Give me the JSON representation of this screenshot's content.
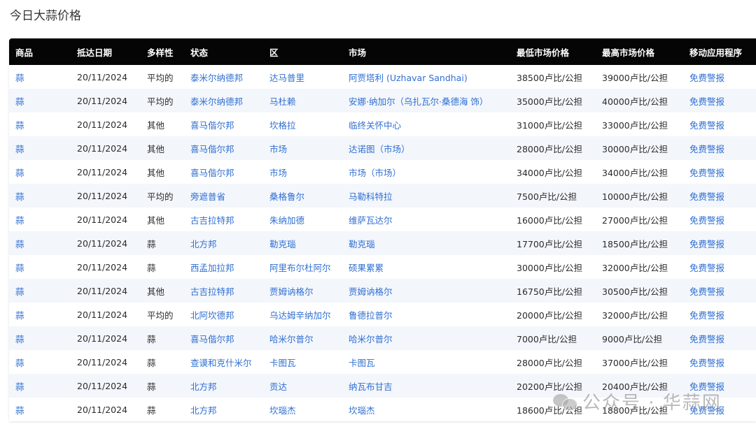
{
  "page": {
    "title": "今日大蒜价格"
  },
  "table": {
    "headers": [
      "商品",
      "抵达日期",
      "多样性",
      "状态",
      "区",
      "市场",
      "最低市场价格",
      "最高市场价格",
      "移动应用程序"
    ],
    "rows": [
      [
        "蒜",
        "20/11/2024",
        "平均的",
        "泰米尔纳德邦",
        "达马普里",
        "阿贾塔利 (Uzhavar Sandhai)",
        "38500卢比/公担",
        "39000卢比/公担",
        "免费警报"
      ],
      [
        "蒜",
        "20/11/2024",
        "平均的",
        "泰米尔纳德邦",
        "马杜赖",
        "安娜·纳加尔（乌扎瓦尔·桑德海 饰）",
        "35000卢比/公担",
        "40000卢比/公担",
        "免费警报"
      ],
      [
        "蒜",
        "20/11/2024",
        "其他",
        "喜马偕尔邦",
        "坎格拉",
        "临终关怀中心",
        "31000卢比/公担",
        "33000卢比/公担",
        "免费警报"
      ],
      [
        "蒜",
        "20/11/2024",
        "其他",
        "喜马偕尔邦",
        "市场",
        "达诺图（市场）",
        "28000卢比/公担",
        "30000卢比/公担",
        "免费警报"
      ],
      [
        "蒜",
        "20/11/2024",
        "其他",
        "喜马偕尔邦",
        "市场",
        "市场（市场）",
        "34000卢比/公担",
        "34000卢比/公担",
        "免费警报"
      ],
      [
        "蒜",
        "20/11/2024",
        "平均的",
        "旁遮普省",
        "桑格鲁尔",
        "马勒科特拉",
        "7500卢比/公担",
        "10000卢比/公担",
        "免费警报"
      ],
      [
        "蒜",
        "20/11/2024",
        "其他",
        "古吉拉特邦",
        "朱纳加德",
        "维萨瓦达尔",
        "16000卢比/公担",
        "27000卢比/公担",
        "免费警报"
      ],
      [
        "蒜",
        "20/11/2024",
        "蒜",
        "北方邦",
        "勒克瑙",
        "勒克瑙",
        "17700卢比/公担",
        "18500卢比/公担",
        "免费警报"
      ],
      [
        "蒜",
        "20/11/2024",
        "蒜",
        "西孟加拉邦",
        "阿里布尔杜阿尔",
        "硕果累累",
        "30000卢比/公担",
        "32000卢比/公担",
        "免费警报"
      ],
      [
        "蒜",
        "20/11/2024",
        "其他",
        "古吉拉特邦",
        "贾姆讷格尔",
        "贾姆讷格尔",
        "16750卢比/公担",
        "30500卢比/公担",
        "免费警报"
      ],
      [
        "蒜",
        "20/11/2024",
        "平均的",
        "北阿坎德邦",
        "乌达姆辛纳加尔",
        "鲁德拉普尔",
        "20000卢比/公担",
        "32000卢比/公担",
        "免费警报"
      ],
      [
        "蒜",
        "20/11/2024",
        "蒜",
        "喜马偕尔邦",
        "哈米尔普尔",
        "哈米尔普尔",
        "7000卢比/公担",
        "9000卢比/公担",
        "免费警报"
      ],
      [
        "蒜",
        "20/11/2024",
        "蒜",
        "查谟和克什米尔",
        "卡图瓦",
        "卡图瓦",
        "28000卢比/公担",
        "37000卢比/公担",
        "免费警报"
      ],
      [
        "蒜",
        "20/11/2024",
        "蒜",
        "北方邦",
        "贡达",
        "纳瓦布甘吉",
        "20200卢比/公担",
        "20400卢比/公担",
        "免费警报"
      ],
      [
        "蒜",
        "20/11/2024",
        "蒜",
        "北方邦",
        "坎瑙杰",
        "坎瑙杰",
        "18600卢比/公担",
        "18800卢比/公担",
        "免费警报"
      ]
    ]
  },
  "watermark": {
    "text": "公众号 · 华蒜网",
    "icon": "wechat-icon"
  }
}
